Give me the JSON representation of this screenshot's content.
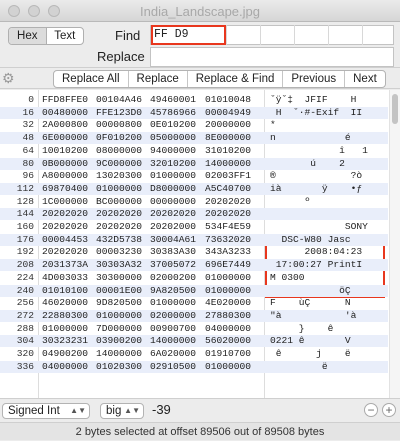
{
  "window": {
    "title": "India_Landscape.jpg"
  },
  "mode": {
    "hex": "Hex",
    "text": "Text"
  },
  "find": {
    "label": "Find",
    "value": "FF D9"
  },
  "replace": {
    "label": "Replace",
    "value": ""
  },
  "toolbar": {
    "gear": "⚙",
    "buttons": [
      "Replace All",
      "Replace",
      "Replace & Find",
      "Previous",
      "Next"
    ]
  },
  "rows": [
    {
      "off": "0",
      "h": [
        "FFD8FFE0",
        "00104A46",
        "49460001",
        "01010048"
      ],
      "t": "ˇÿˇ‡  JFIF    H"
    },
    {
      "off": "16",
      "h": [
        "00480000",
        "FFE123D0",
        "45786966",
        "00004949"
      ],
      "t": " H  ˇ·#-Exif  II"
    },
    {
      "off": "32",
      "h": [
        "2A000800",
        "00000800",
        "0E010200",
        "20000000"
      ],
      "t": "*"
    },
    {
      "off": "48",
      "h": [
        "6E000000",
        "0F010200",
        "05000000",
        "8E000000"
      ],
      "t": "n            é"
    },
    {
      "off": "64",
      "h": [
        "10010200",
        "08000000",
        "94000000",
        "31010200"
      ],
      "t": "            î   1"
    },
    {
      "off": "80",
      "h": [
        "0B000000",
        "9C000000",
        "32010200",
        "14000000"
      ],
      "t": "       ú    2"
    },
    {
      "off": "96",
      "h": [
        "A8000000",
        "13020300",
        "01000000",
        "02003FF1"
      ],
      "t": "®             ?ò"
    },
    {
      "off": "112",
      "h": [
        "69870400",
        "01000000",
        "D8000000",
        "A5C40700"
      ],
      "t": "ià       ÿ    •ƒ"
    },
    {
      "off": "128",
      "h": [
        "1C000000",
        "BC000000",
        "00000000",
        "20202020"
      ],
      "t": "      º"
    },
    {
      "off": "144",
      "h": [
        "20202020",
        "20202020",
        "20202020",
        "20202020"
      ],
      "t": ""
    },
    {
      "off": "160",
      "h": [
        "20202020",
        "20202020",
        "20202000",
        "534F4E59"
      ],
      "t": "             SONY"
    },
    {
      "off": "176",
      "h": [
        "00004453",
        "432D5738",
        "30004A61",
        "73632020"
      ],
      "t": "  DSC-W80 Jasc"
    },
    {
      "off": "192",
      "h": [
        "20202020",
        "00003230",
        "30383A30",
        "343A3233"
      ],
      "t": "      2008:04:23"
    },
    {
      "off": "208",
      "h": [
        "2031373A",
        "30303A32",
        "37005072",
        "696E7449"
      ],
      "t": " 17:00:27 PrintI"
    },
    {
      "off": "224",
      "h": [
        "4D003033",
        "30300000",
        "02000200",
        "01000000"
      ],
      "t": "M 0300"
    },
    {
      "off": "240",
      "h": [
        "01010100",
        "00001E00",
        "9A820500",
        "01000000"
      ],
      "t": "            öÇ"
    },
    {
      "off": "256",
      "h": [
        "46020000",
        "9D820500",
        "01000000",
        "4E020000"
      ],
      "t": "F    ùÇ      N"
    },
    {
      "off": "272",
      "h": [
        "22880300",
        "01000000",
        "02000000",
        "27880300"
      ],
      "t": "\"à           'à"
    },
    {
      "off": "288",
      "h": [
        "01000000",
        "7D000000",
        "00900700",
        "04000000"
      ],
      "t": "     }    ê"
    },
    {
      "off": "304",
      "h": [
        "30323231",
        "03900200",
        "14000000",
        "56020000"
      ],
      "t": "0221 ê       V"
    },
    {
      "off": "320",
      "h": [
        "04900200",
        "14000000",
        "6A020000",
        "01910700"
      ],
      "t": " ê      j    ë"
    },
    {
      "off": "336",
      "h": [
        "04000000",
        "01020300",
        "02910500",
        "01000000"
      ],
      "t": "         ë"
    }
  ],
  "bottom": {
    "type": "Signed Int",
    "endian": "big",
    "value": "-39",
    "minus": "−",
    "plus": "+"
  },
  "status": "2 bytes selected at offset 89506 out of 89508 bytes"
}
